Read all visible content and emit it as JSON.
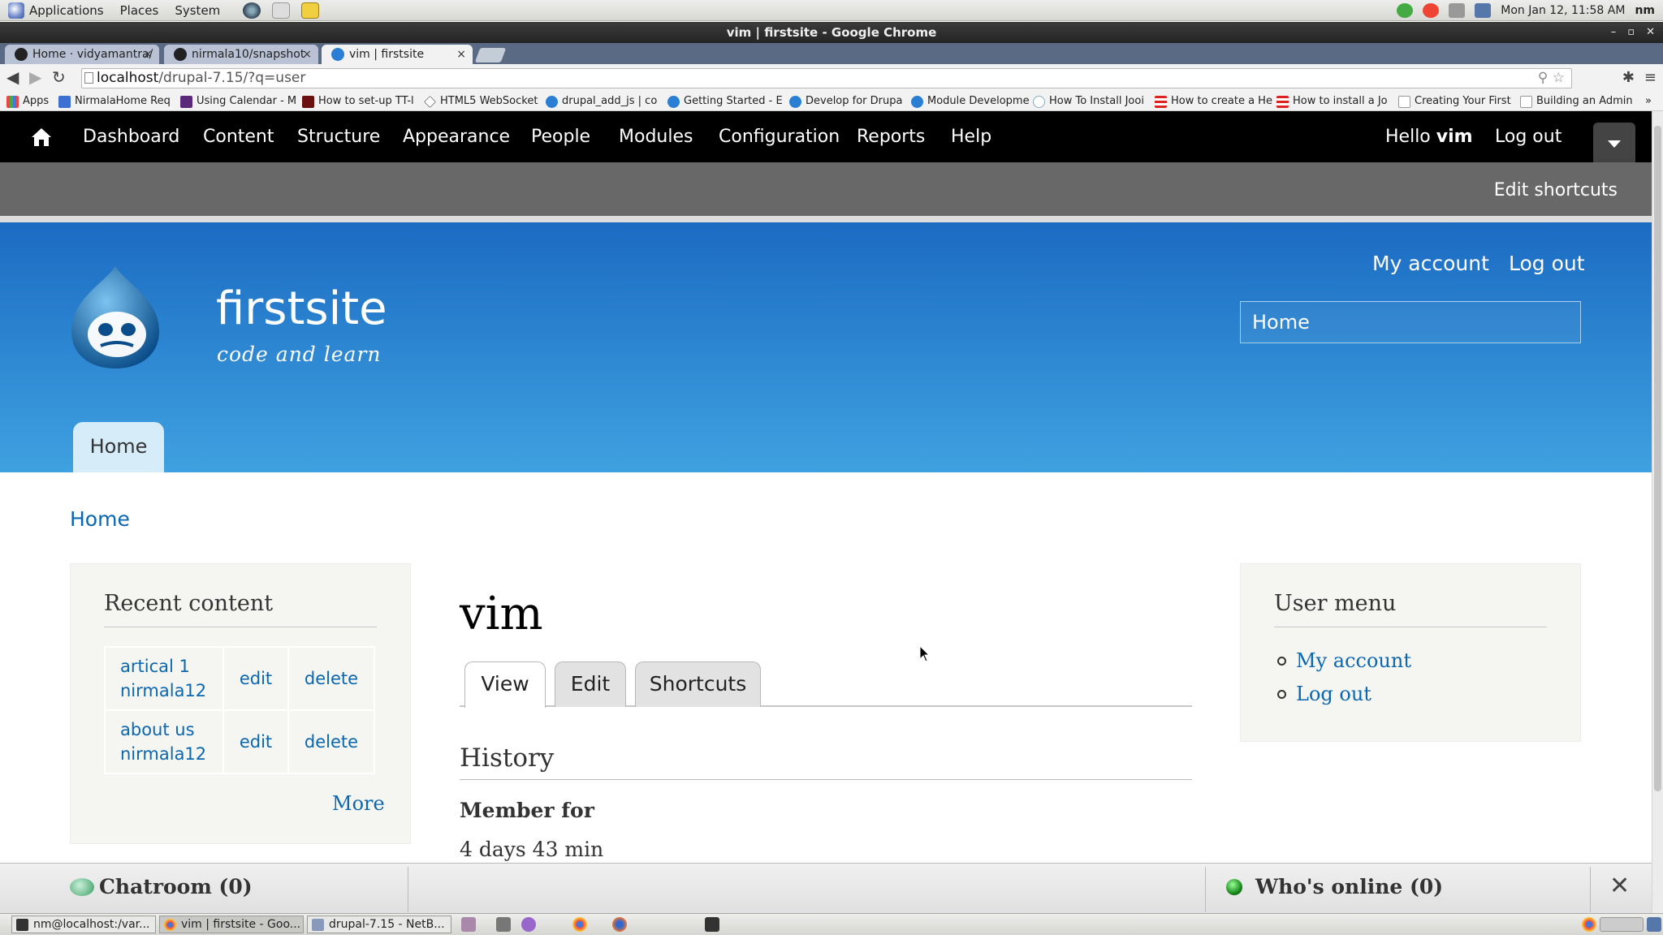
{
  "gnome_panel": {
    "menus": [
      "Applications",
      "Places",
      "System"
    ],
    "datetime": "Mon Jan 12, 11:58 AM",
    "user": "nm"
  },
  "window": {
    "title": "vim | firstsite - Google Chrome"
  },
  "tabs": [
    {
      "label": "Home · vidyamantra/",
      "close": "×"
    },
    {
      "label": "nirmala10/snapshot",
      "close": "×"
    },
    {
      "label": "vim | firstsite",
      "close": "×"
    }
  ],
  "address_bar": {
    "host": "localhost",
    "path": "/drupal-7.15/?q=user"
  },
  "bookmarks": [
    "Apps",
    "NirmalaHome Req",
    "Using Calendar - M",
    "How to set-up TT-l",
    "HTML5 WebSocket",
    "drupal_add_js | co",
    "Getting Started - E",
    "Develop for Drupa",
    "Module Developme",
    "How To Install Jooi",
    "How to create a He",
    "How to install a Jo",
    "Creating Your First",
    "Building an Admin"
  ],
  "admin_toolbar": {
    "items": [
      "Dashboard",
      "Content",
      "Structure",
      "Appearance",
      "People",
      "Modules",
      "Configuration",
      "Reports",
      "Help"
    ],
    "hello_prefix": "Hello",
    "username": "vim",
    "logout": "Log out"
  },
  "shortcut_bar": {
    "edit_shortcuts": "Edit shortcuts"
  },
  "header": {
    "site_name": "firstsite",
    "slogan": "code and learn",
    "secondary_menu": [
      "My account",
      "Log out"
    ],
    "search_value": "Home",
    "main_tab": "Home"
  },
  "breadcrumb": "Home",
  "recent_content": {
    "title": "Recent content",
    "rows": [
      {
        "title": "artical 1",
        "author": "nirmala12",
        "edit": "edit",
        "delete": "delete"
      },
      {
        "title": "about us",
        "author": "nirmala12",
        "edit": "edit",
        "delete": "delete"
      }
    ],
    "more": "More"
  },
  "main": {
    "page_title": "vim",
    "tabs": [
      "View",
      "Edit",
      "Shortcuts"
    ],
    "history_title": "History",
    "member_for_label": "Member for",
    "member_for_value": "4 days 43 min"
  },
  "user_menu": {
    "title": "User menu",
    "items": [
      "My account",
      "Log out"
    ]
  },
  "chat_bar": {
    "chatroom": "Chatroom (0)",
    "whos_online": "Who's online (0)",
    "close": "✕"
  },
  "taskbar": {
    "tasks": [
      "nm@localhost:/var...",
      "vim | firstsite - Goo...",
      "drupal-7.15 - NetB..."
    ]
  },
  "colors": {
    "link": "#0a67b0",
    "header_top": "#1b6bc2",
    "header_bottom": "#3fa1e0",
    "admin_bar": "#000000",
    "shortcut_bar": "#686868"
  }
}
